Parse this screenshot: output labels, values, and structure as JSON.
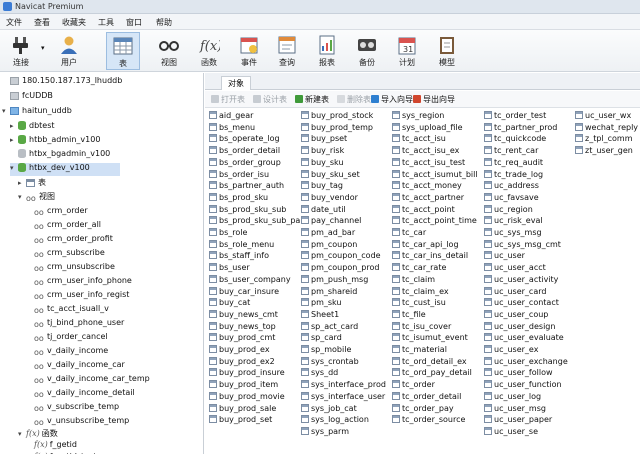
{
  "app": {
    "title": "Navicat Premium"
  },
  "menu": [
    "文件",
    "查看",
    "收藏夹",
    "工具",
    "窗口",
    "帮助"
  ],
  "toolbar": [
    {
      "label": "连接",
      "icon": "connect-icon"
    },
    {
      "label": "用户",
      "icon": "user-icon"
    },
    {
      "label": "表",
      "icon": "table-icon",
      "active": true
    },
    {
      "label": "视图",
      "icon": "view-icon"
    },
    {
      "label": "函数",
      "icon": "function-icon"
    },
    {
      "label": "事件",
      "icon": "event-icon"
    },
    {
      "label": "查询",
      "icon": "query-icon"
    },
    {
      "label": "报表",
      "icon": "report-icon"
    },
    {
      "label": "备份",
      "icon": "backup-icon"
    },
    {
      "label": "计划",
      "icon": "schedule-icon"
    },
    {
      "label": "模型",
      "icon": "model-icon"
    }
  ],
  "sidebar": {
    "connections": [
      {
        "label": "180.150.187.173_lhuddb",
        "type": "server"
      },
      {
        "label": "fcUDDB",
        "type": "server"
      },
      {
        "label": "haitun_uddb",
        "type": "server-open"
      }
    ],
    "databases": [
      {
        "label": "dbtest",
        "on": true
      },
      {
        "label": "htbb_admin_v100",
        "on": true
      },
      {
        "label": "htbx_bgadmin_v100",
        "on": false
      },
      {
        "label": "htbx_dev_v100",
        "on": true,
        "selected": true
      }
    ],
    "table_node": "表",
    "view_node": "视图",
    "views": [
      "crm_order",
      "crm_order_all",
      "crm_order_profit",
      "crm_subscribe",
      "crm_unsubscribe",
      "crm_user_info_phone",
      "crm_user_info_regist",
      "tc_acct_isuall_v",
      "tj_bind_phone_user",
      "tj_order_cancel",
      "v_daily_income",
      "v_daily_income_car",
      "v_daily_income_car_temp",
      "v_daily_income_detail",
      "v_subscribe_temp",
      "v_unsubscribe_temp"
    ],
    "function_node": "函数",
    "functions": [
      "f_getid",
      "f_getid_test"
    ]
  },
  "content": {
    "tab": "对象",
    "actions": [
      {
        "label": "打开表",
        "enabled": false,
        "color": "#9aa0a7"
      },
      {
        "label": "设计表",
        "enabled": false,
        "color": "#9aa0a7"
      },
      {
        "label": "新建表",
        "enabled": true,
        "color": "#3f9a3a"
      },
      {
        "label": "删除表",
        "enabled": false,
        "color": "#c0c4c9"
      },
      {
        "label": "导入向导",
        "enabled": true,
        "color": "#2e7fd0"
      },
      {
        "label": "导出向导",
        "enabled": true,
        "color": "#d0462e"
      }
    ],
    "columns": [
      [
        "aid_gear",
        "bs_menu",
        "bs_operate_log",
        "bs_order_detail",
        "bs_order_group",
        "bs_order_isu",
        "bs_partner_auth",
        "bs_prod_sku",
        "bs_prod_sku_sub",
        "bs_prod_sku_sub_para",
        "bs_role",
        "bs_role_menu",
        "bs_staff_info",
        "bs_user",
        "bs_user_company",
        "buy_car_insure",
        "buy_cat",
        "buy_news_cmt",
        "buy_news_top",
        "buy_prod_cmt",
        "buy_prod_ex",
        "buy_prod_ex2",
        "buy_prod_insure",
        "buy_prod_item",
        "buy_prod_movie",
        "buy_prod_sale",
        "buy_prod_set"
      ],
      [
        "buy_prod_stock",
        "buy_prod_temp",
        "buy_pset",
        "buy_risk",
        "buy_sku",
        "buy_sku_set",
        "buy_tag",
        "buy_vendor",
        "date_util",
        "pay_channel",
        "pm_ad_bar",
        "pm_coupon",
        "pm_coupon_code",
        "pm_coupon_prod",
        "pm_push_msg",
        "pm_shareid",
        "pm_sku",
        "Sheet1",
        "sp_act_card",
        "sp_card",
        "sp_mobile",
        "sys_crontab",
        "sys_dd",
        "sys_interface_prod",
        "sys_interface_user",
        "sys_job_cat",
        "sys_log_action",
        "sys_parm"
      ],
      [
        "sys_region",
        "sys_upload_file",
        "tc_acct_isu",
        "tc_acct_isu_ex",
        "tc_acct_isu_test",
        "tc_acct_isumut_bill",
        "tc_acct_money",
        "tc_acct_partner",
        "tc_acct_point",
        "tc_acct_point_time",
        "tc_car",
        "tc_car_api_log",
        "tc_car_ins_detail",
        "tc_car_rate",
        "tc_claim",
        "tc_claim_ex",
        "tc_cust_isu",
        "tc_file",
        "tc_isu_cover",
        "tc_isumut_event",
        "tc_material",
        "tc_ord_detail_ex",
        "tc_ord_pay_detail",
        "tc_order",
        "tc_order_detail",
        "tc_order_pay",
        "tc_order_source"
      ],
      [
        "tc_order_test",
        "tc_partner_prod",
        "tc_quickcode",
        "tc_rent_car",
        "tc_req_audit",
        "tc_trade_log",
        "uc_address",
        "uc_favsave",
        "uc_region",
        "uc_risk_eval",
        "uc_sys_msg",
        "uc_sys_msg_cmt",
        "uc_user",
        "uc_user_acct",
        "uc_user_activity",
        "uc_user_card",
        "uc_user_contact",
        "uc_user_coup",
        "uc_user_design",
        "uc_user_evaluate",
        "uc_user_ex",
        "uc_user_exchange",
        "uc_user_follow",
        "uc_user_function",
        "uc_user_log",
        "uc_user_msg",
        "uc_user_paper",
        "uc_user_se"
      ],
      [
        "uc_user_wx",
        "wechat_reply",
        "z_tpl_comm",
        "zt_user_gen"
      ]
    ]
  }
}
